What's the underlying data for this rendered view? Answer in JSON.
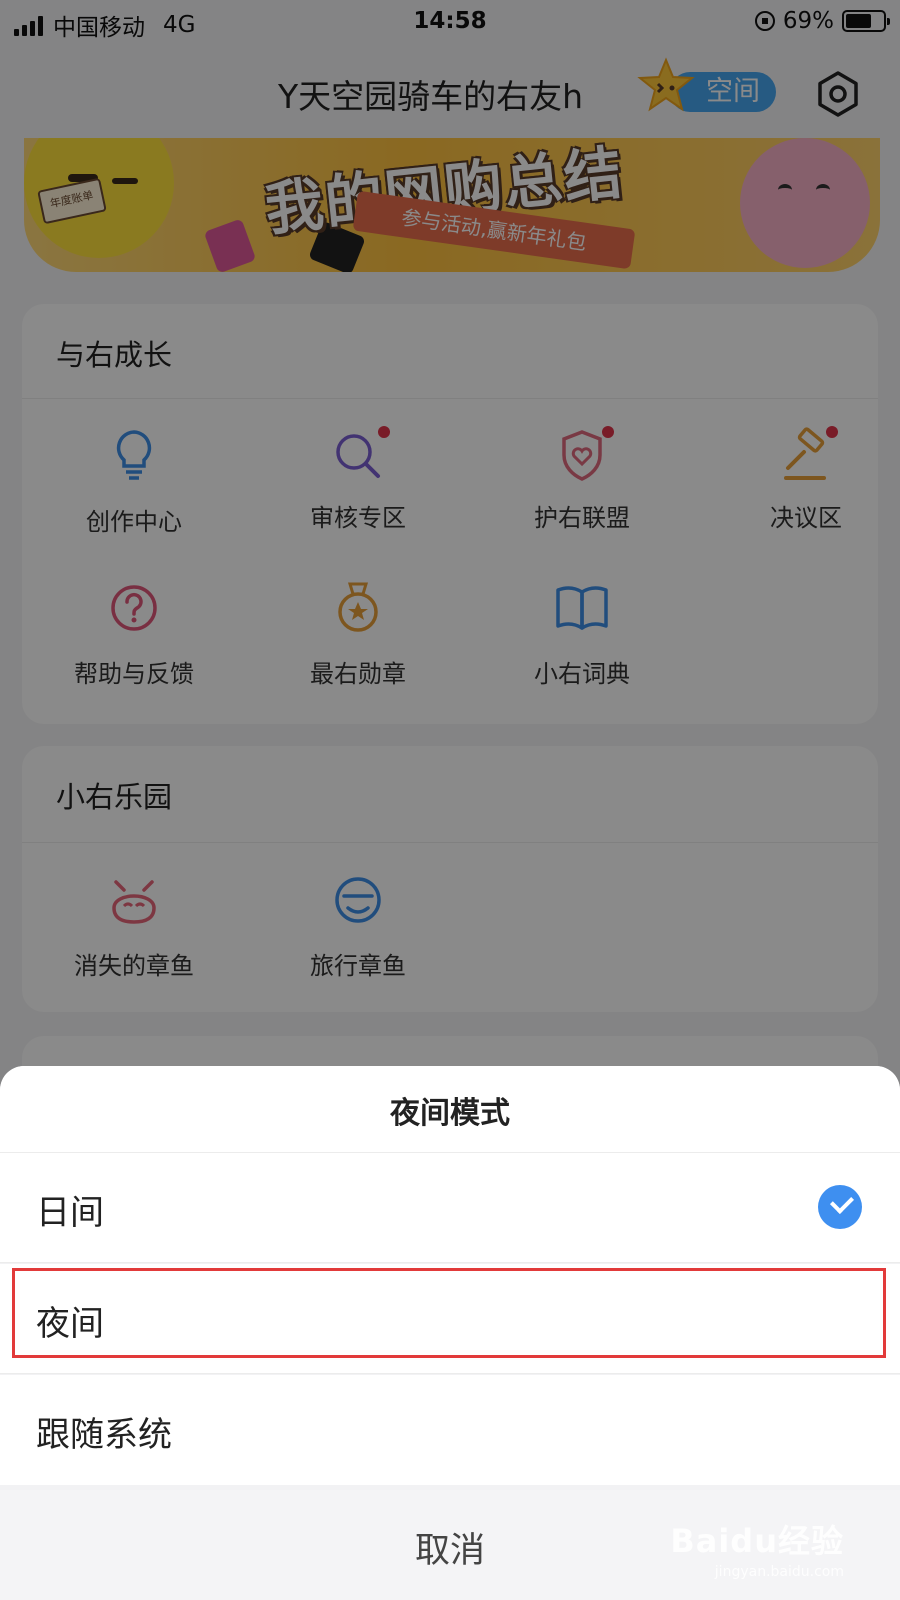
{
  "status_bar": {
    "carrier": "中国移动",
    "network": "4G",
    "time": "14:58",
    "battery": "69%",
    "battery_level": 0.69
  },
  "header": {
    "title": "Y天空园骑车的右友h",
    "space_label": "空间",
    "icons": [
      "star-mascot-icon",
      "settings-gear-icon"
    ]
  },
  "banner": {
    "title": "我的网购总结",
    "subtitle": "参与活动,赢新年礼包",
    "tag": "年度账单"
  },
  "growth_section": {
    "title": "与右成长",
    "items": [
      {
        "label": "创作中心",
        "icon": "lightbulb-icon",
        "color": "#3d8ee8",
        "dot": false
      },
      {
        "label": "审核专区",
        "icon": "magnifier-icon",
        "color": "#7a5fd3",
        "dot": true
      },
      {
        "label": "护右联盟",
        "icon": "shield-heart-icon",
        "color": "#e0697e",
        "dot": true
      },
      {
        "label": "决议区",
        "icon": "gavel-icon",
        "color": "#e8a03a",
        "dot": true
      },
      {
        "label": "帮助与反馈",
        "icon": "help-question-icon",
        "color": "#e0577a",
        "dot": false
      },
      {
        "label": "最右勋章",
        "icon": "medal-icon",
        "color": "#e8a03a",
        "dot": false
      },
      {
        "label": "小右词典",
        "icon": "book-icon",
        "color": "#3d8ee8",
        "dot": false
      }
    ]
  },
  "park_section": {
    "title": "小右乐园",
    "items": [
      {
        "label": "消失的章鱼",
        "icon": "octopus-icon",
        "color": "#e8677a"
      },
      {
        "label": "旅行章鱼",
        "icon": "travel-octopus-icon",
        "color": "#3d8ee8"
      }
    ]
  },
  "sheet": {
    "title": "夜间模式",
    "options": [
      {
        "label": "日间",
        "selected": true
      },
      {
        "label": "夜间",
        "selected": false
      },
      {
        "label": "跟随系统",
        "selected": false
      }
    ],
    "cancel": "取消"
  },
  "watermark": {
    "brand": "Baidu经验",
    "url": "jingyan.baidu.com"
  },
  "colors": {
    "accent_blue": "#3e8ff0",
    "highlight_red": "#e23a3a",
    "notify_dot": "#e0344a"
  }
}
